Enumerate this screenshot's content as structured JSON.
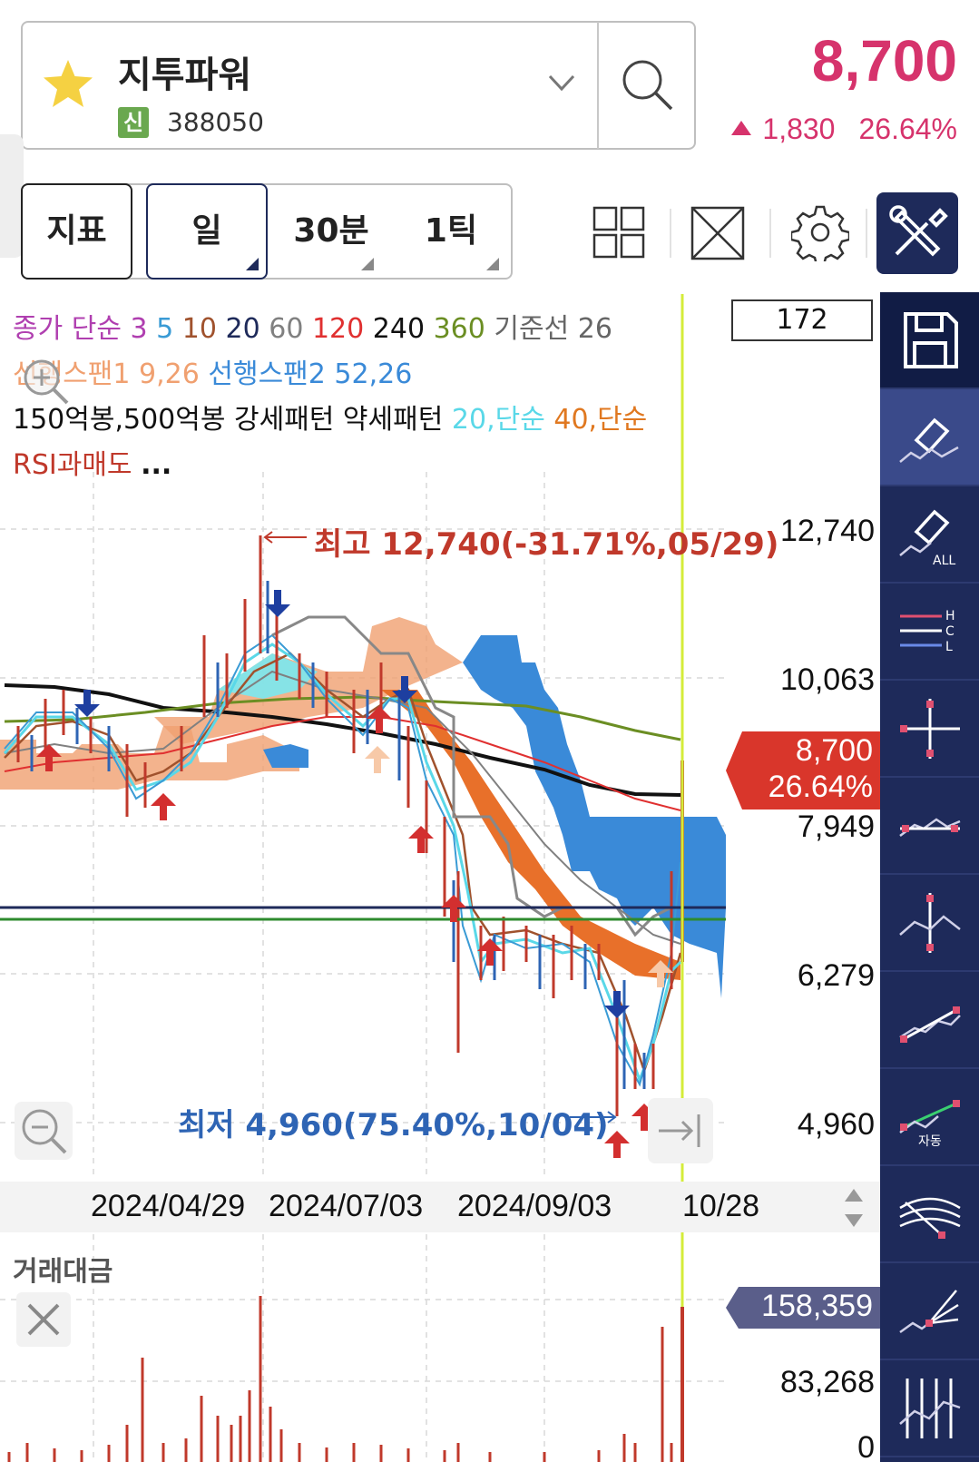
{
  "header": {
    "stock_name": "지투파워",
    "credit_badge": "신",
    "stock_code": "388050",
    "price": "8,700",
    "change_amount": "1,830",
    "change_percent": "26.64%",
    "up_color": "#d6336c"
  },
  "toolbar": {
    "indicator_label": "지표",
    "period_day": "일",
    "period_30min": "30분",
    "period_tick": "1틱"
  },
  "legend": {
    "row1": [
      {
        "text": "종가 단순",
        "color": "#b03fb0"
      },
      {
        "text": "3",
        "color": "#b03fb0"
      },
      {
        "text": "5",
        "color": "#3a9bd5"
      },
      {
        "text": "10",
        "color": "#a0522d"
      },
      {
        "text": "20",
        "color": "#1e2a5a"
      },
      {
        "text": "60",
        "color": "#808080"
      },
      {
        "text": "120",
        "color": "#e03030"
      },
      {
        "text": "240",
        "color": "#111111"
      },
      {
        "text": "360",
        "color": "#6b8e23"
      },
      {
        "text": "기준선 26",
        "color": "#666666"
      }
    ],
    "row2": [
      {
        "text": "선행스팬1 9,26",
        "color": "#f0a070"
      },
      {
        "text": "선행스팬2 52,26",
        "color": "#3a8ad8"
      }
    ],
    "row3": [
      {
        "text": "150억봉,500억봉 강세패턴 약세패턴",
        "color": "#111111"
      },
      {
        "text": "20,단순",
        "color": "#5ad8e8"
      },
      {
        "text": "40,단순",
        "color": "#e07820"
      }
    ],
    "row4": [
      {
        "text": "RSI과매도",
        "color": "#c0392b"
      },
      {
        "text": "...",
        "color": "#111111"
      }
    ]
  },
  "period_count": "172",
  "price_axis": [
    "12,740",
    "10,063",
    "7,949",
    "6,279",
    "4,960"
  ],
  "current_tag": {
    "price": "8,700",
    "percent": "26.64%"
  },
  "high_annotation": "최고 12,740(-31.71%,05/29)",
  "low_annotation": "최저 4,960(75.40%,10/04)",
  "dates": [
    "2024/04/29",
    "2024/07/03",
    "2024/09/03",
    "10/28"
  ],
  "volume": {
    "title": "거래대금",
    "tag": "158,359",
    "axis": [
      "83,268",
      "0"
    ]
  },
  "right_toolbar": [
    "save-icon",
    "eraser-icon",
    "eraser-all-icon",
    "hcl-line-icon",
    "crosshair-icon",
    "horizontal-line-icon",
    "vertical-line-icon",
    "trend-line-icon",
    "auto-trend-icon",
    "fan-arc-icon",
    "fan-lines-icon",
    "grid-lines-icon"
  ],
  "colors": {
    "toolbar_bg": "#1e2a5a",
    "current_tag_bg": "#d9362b",
    "volume_tag_bg": "#5a5e8a",
    "today_line": "#d4ec3a"
  }
}
